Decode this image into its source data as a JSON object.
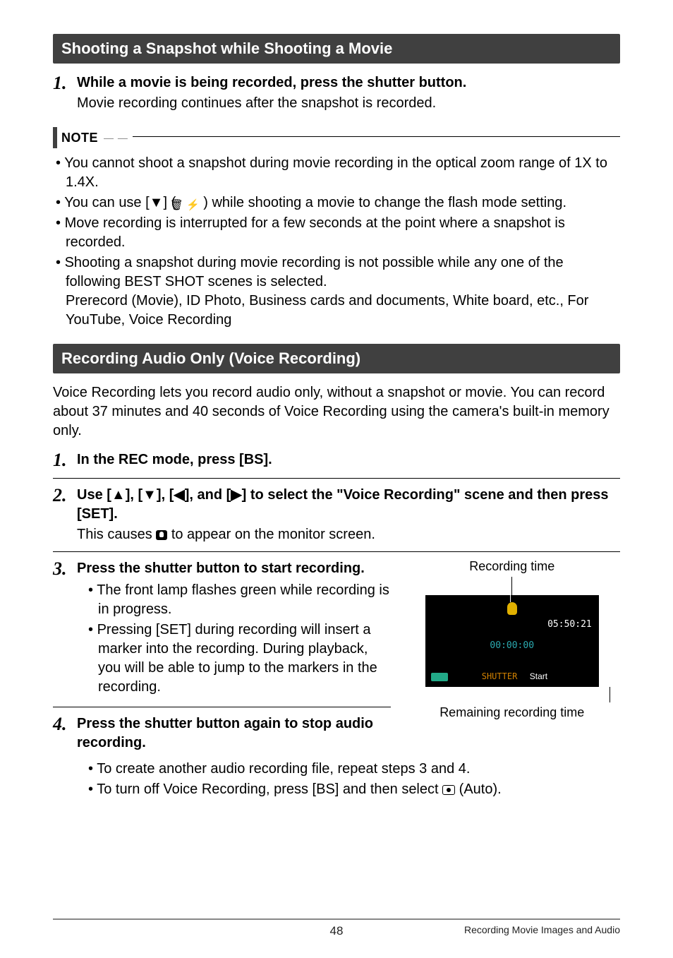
{
  "section1": {
    "title": "Shooting a Snapshot while Shooting a Movie"
  },
  "step1": {
    "num": "1.",
    "head": "While a movie is being recorded, press the shutter button.",
    "desc": "Movie recording continues after the snapshot is recorded."
  },
  "note": {
    "label": "NOTE",
    "b1": "You cannot shoot a snapshot during movie recording in the optical zoom range of 1X to 1.4X.",
    "b2a": "You can use [▼] (",
    "b2b": ") while shooting a movie to change the flash mode setting.",
    "b3": "Move recording is interrupted for a few seconds at the point where a snapshot is recorded.",
    "b4": "Shooting a snapshot during movie recording is not possible while any one of the following BEST SHOT scenes is selected.",
    "b4cont": "Prerecord (Movie), ID Photo, Business cards and documents, White board, etc., For YouTube, Voice Recording"
  },
  "section2": {
    "title": "Recording Audio Only (Voice Recording)",
    "para": "Voice Recording lets you record audio only, without a snapshot or movie. You can record about 37 minutes and 40 seconds of Voice Recording using the camera's built-in memory only."
  },
  "s2step1": {
    "num": "1.",
    "head": "In the REC mode, press [BS]."
  },
  "s2step2": {
    "num": "2.",
    "head": "Use [▲], [▼], [◀], and [▶] to select the \"Voice Recording\" scene and then press [SET].",
    "desc1": "This causes ",
    "desc2": " to appear on the monitor screen."
  },
  "s2step3": {
    "num": "3.",
    "head": "Press the shutter button to start recording.",
    "b1": "The front lamp flashes green while recording is in progress.",
    "b2": "Pressing [SET] during recording will insert a marker into the recording. During playback, you will be able to jump to the markers in the recording."
  },
  "s2step4": {
    "num": "4.",
    "head": "Press the shutter button again to stop audio recording.",
    "b1": "To create another audio recording file, repeat steps 3 and 4.",
    "b2a": "To turn off Voice Recording, press [BS] and then select ",
    "b2b": " (Auto)."
  },
  "fig": {
    "topLabel": "Recording time",
    "remtime": "05:50:21",
    "elapsed": "00:00:00",
    "shutter": "SHUTTER",
    "start": "Start",
    "bottomLabel": "Remaining recording time"
  },
  "footer": {
    "pagenum": "48",
    "section": "Recording Movie Images and Audio"
  }
}
